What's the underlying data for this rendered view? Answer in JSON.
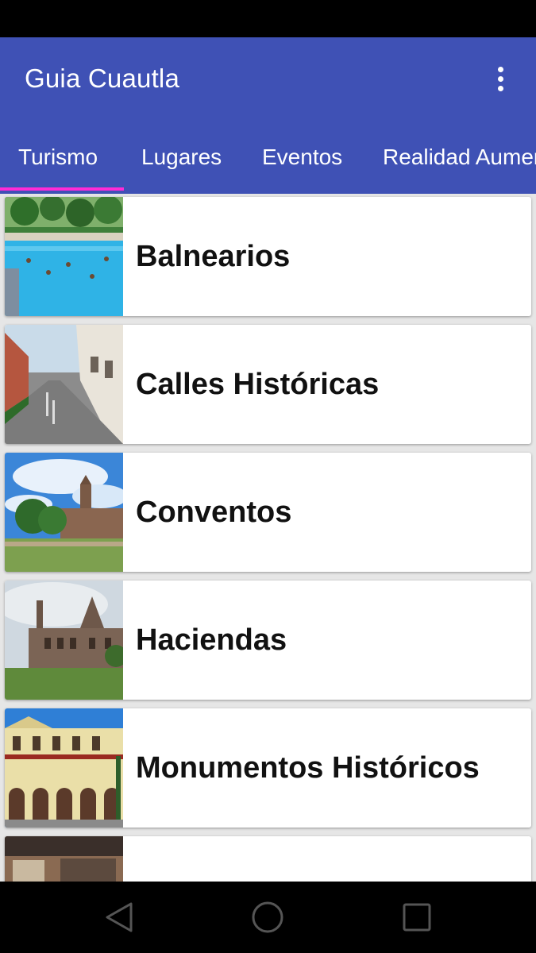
{
  "app": {
    "title": "Guia Cuautla",
    "accent_color": "#3f51b5",
    "tab_indicator_color": "#ff2bd6",
    "menu_icon": "more-vert-icon"
  },
  "tabs": [
    {
      "label": "Turismo",
      "selected": true
    },
    {
      "label": "Lugares",
      "selected": false
    },
    {
      "label": "Eventos",
      "selected": false
    },
    {
      "label": "Realidad Aumentada",
      "selected": false
    }
  ],
  "items": [
    {
      "label": "Balnearios",
      "image": "swimming-pool-photo"
    },
    {
      "label": "Calles Históricas",
      "image": "street-photo"
    },
    {
      "label": "Conventos",
      "image": "convent-photo"
    },
    {
      "label": "Haciendas",
      "image": "hacienda-ruins-photo"
    },
    {
      "label": "Monumentos Históricos",
      "image": "colonial-building-photo"
    },
    {
      "label": "",
      "image": "museum-interior-photo"
    }
  ],
  "nav": {
    "back_icon": "back-triangle-icon",
    "home_icon": "home-circle-icon",
    "recents_icon": "recents-square-icon"
  }
}
